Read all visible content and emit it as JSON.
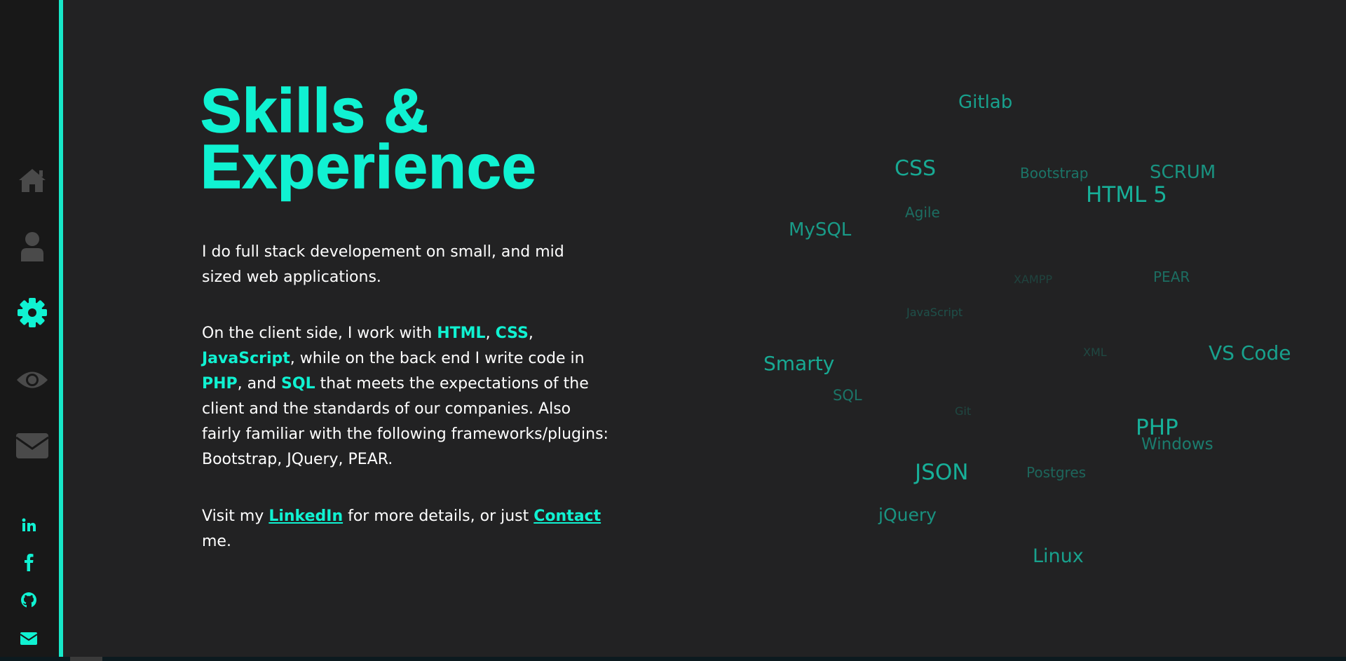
{
  "nav": {
    "items": [
      {
        "name": "home",
        "icon": "home-icon",
        "active": false
      },
      {
        "name": "about",
        "icon": "user-icon",
        "active": false
      },
      {
        "name": "skills",
        "icon": "gear-icon",
        "active": true
      },
      {
        "name": "work",
        "icon": "eye-icon",
        "active": false
      },
      {
        "name": "contact",
        "icon": "envelope-icon",
        "active": false
      }
    ],
    "colors": {
      "active": "#10f2d2",
      "inactive": "#4a4a4a"
    }
  },
  "social": {
    "items": [
      {
        "name": "linkedin",
        "icon": "linkedin-icon",
        "glyph": "in"
      },
      {
        "name": "facebook",
        "icon": "facebook-icon",
        "glyph": "f"
      },
      {
        "name": "github",
        "icon": "github-icon"
      },
      {
        "name": "email",
        "icon": "envelope-icon"
      }
    ],
    "color": "#10f2d2"
  },
  "page": {
    "title_line1": "Skills &",
    "title_line2": "Experience",
    "intro": "I do full stack developement on small, and mid sized web applications.",
    "p2": {
      "t1": "On the client side, I work with ",
      "html": "HTML",
      "sep1": ", ",
      "css": "CSS",
      "sep2": ",",
      "js": "JavaScript",
      "t2": ", while on the back end I write code in ",
      "php": "PHP",
      "t3": ", and ",
      "sql": "SQL",
      "t4": " that meets the expectations of the client and the standards of our companies. Also fairly familiar with the following frameworks/plugins: Bootstrap, JQuery, PEAR."
    },
    "p3": {
      "t1": "Visit my ",
      "linkedin": "LinkedIn",
      "t2": " for more details, or just ",
      "contact": "Contact",
      "t3": " me."
    }
  },
  "skill_cloud": {
    "accent": "#17b8a0",
    "words": [
      {
        "text": "Gitlab"
      },
      {
        "text": "CSS"
      },
      {
        "text": "Bootstrap"
      },
      {
        "text": "SCRUM"
      },
      {
        "text": "HTML 5"
      },
      {
        "text": "Agile"
      },
      {
        "text": "MySQL"
      },
      {
        "text": "XAMPP"
      },
      {
        "text": "PEAR"
      },
      {
        "text": "JavaScript"
      },
      {
        "text": "XML"
      },
      {
        "text": "VS Code"
      },
      {
        "text": "Smarty"
      },
      {
        "text": "SQL"
      },
      {
        "text": "Git"
      },
      {
        "text": "PHP"
      },
      {
        "text": "Windows"
      },
      {
        "text": "JSON"
      },
      {
        "text": "Postgres"
      },
      {
        "text": "jQuery"
      },
      {
        "text": "Linux"
      }
    ]
  }
}
